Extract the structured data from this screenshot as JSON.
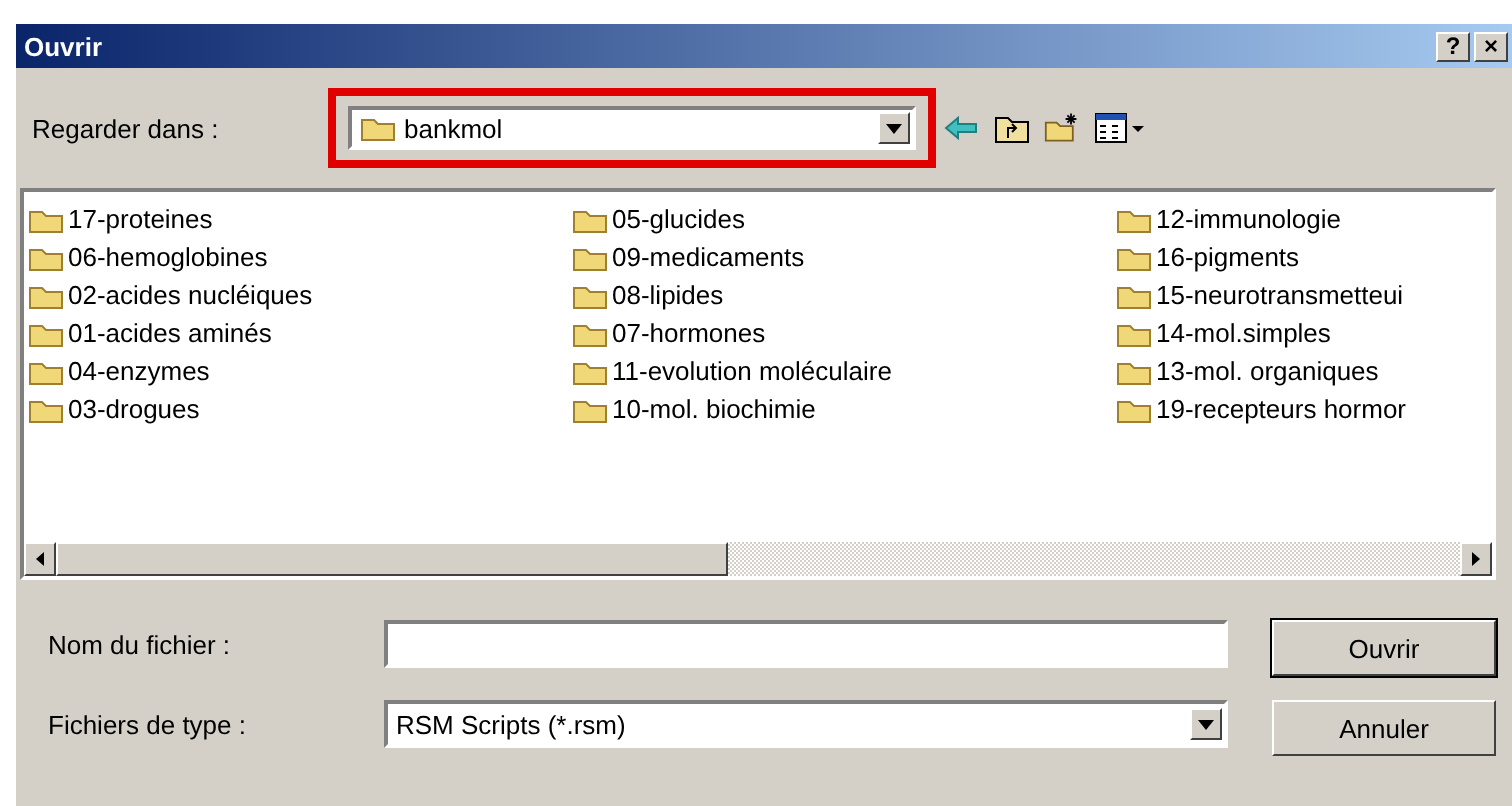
{
  "window": {
    "title": "Ouvrir",
    "buttons": [
      "?",
      "×"
    ]
  },
  "look_in": {
    "label": "Regarder dans :",
    "value": "bankmol",
    "highlighted": true
  },
  "files": [
    {
      "name": "17-proteines"
    },
    {
      "name": "06-hemoglobines"
    },
    {
      "name": "02-acides nucléiques"
    },
    {
      "name": "01-acides aminés"
    },
    {
      "name": "04-enzymes"
    },
    {
      "name": "03-drogues"
    },
    {
      "name": "05-glucides"
    },
    {
      "name": "09-medicaments"
    },
    {
      "name": "08-lipides"
    },
    {
      "name": "07-hormones"
    },
    {
      "name": "11-evolution moléculaire"
    },
    {
      "name": "10-mol. biochimie"
    },
    {
      "name": "12-immunologie"
    },
    {
      "name": "16-pigments"
    },
    {
      "name": "15-neurotransmetteui"
    },
    {
      "name": "14-mol.simples"
    },
    {
      "name": "13-mol. organiques"
    },
    {
      "name": "19-recepteurs hormor"
    }
  ],
  "file_name": {
    "label": "Nom du fichier :"
  },
  "file_type": {
    "label": "Fichiers de type :",
    "value": "RSM Scripts (*.rsm)"
  },
  "buttons": [
    "Ouvrir",
    "Annuler"
  ]
}
